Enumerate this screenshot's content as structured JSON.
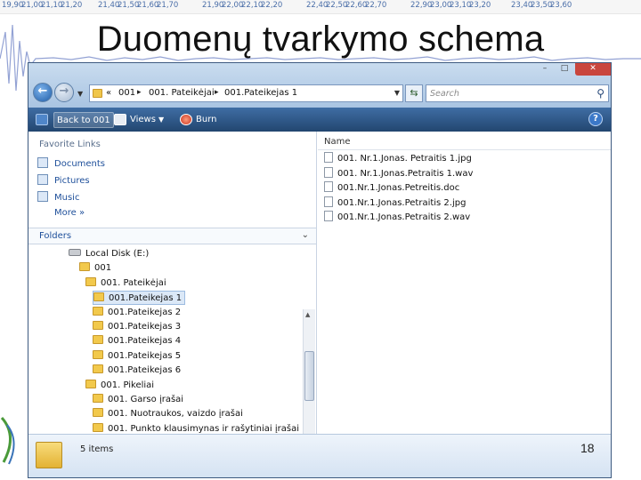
{
  "timeline": [
    "19,90",
    "21,00",
    "21,10",
    "21,20",
    "21,40",
    "21,50",
    "21,60",
    "21,70",
    "21,90",
    "22,00",
    "22,10",
    "22,20",
    "22,40",
    "22,50",
    "22,60",
    "22,70",
    "22,90",
    "23,00",
    "23,10",
    "23,20",
    "23,40",
    "23,50",
    "23,60"
  ],
  "slide": {
    "title": "Duomenų tvarkymo schema",
    "page_number": "18"
  },
  "window": {
    "address": {
      "overflow": "«",
      "crumbs": [
        "001",
        "001. Pateikėjai",
        "001.Pateikejas 1"
      ]
    },
    "search_placeholder": "Search",
    "toolbar": {
      "back_label": "Back to 001",
      "views_label": "Views",
      "burn_label": "Burn"
    },
    "favorites": {
      "header": "Favorite Links",
      "items": [
        "Documents",
        "Pictures",
        "Music",
        "More »"
      ]
    },
    "folders_label": "Folders",
    "tree": [
      {
        "label": "Local Disk (E:)",
        "level": 0,
        "kind": "drive"
      },
      {
        "label": "001",
        "level": 1,
        "kind": "folder"
      },
      {
        "label": "001. Pateikėjai",
        "level": 2,
        "kind": "folder"
      },
      {
        "label": "001.Pateikejas 1",
        "level": 3,
        "kind": "folder",
        "selected": true
      },
      {
        "label": "001.Pateikejas 2",
        "level": 3,
        "kind": "folder"
      },
      {
        "label": "001.Pateikejas 3",
        "level": 3,
        "kind": "folder"
      },
      {
        "label": "001.Pateikejas 4",
        "level": 3,
        "kind": "folder"
      },
      {
        "label": "001.Pateikejas 5",
        "level": 3,
        "kind": "folder"
      },
      {
        "label": "001.Pateikejas 6",
        "level": 3,
        "kind": "folder"
      },
      {
        "label": "001. Pikeliai",
        "level": 2,
        "kind": "folder"
      },
      {
        "label": "001. Garso įrašai",
        "level": 3,
        "kind": "folder"
      },
      {
        "label": "001. Nuotraukos, vaizdo įrašai",
        "level": 3,
        "kind": "folder"
      },
      {
        "label": "001. Punkto klausimynas ir rašytiniai įrašai",
        "level": 3,
        "kind": "folder"
      }
    ],
    "files_header": "Name",
    "files": [
      "001. Nr.1.Jonas. Petraitis 1.jpg",
      "001. Nr.1.Jonas.Petraitis 1.wav",
      "001.Nr.1.Jonas.Petreitis.doc",
      "001.Nr.1.Jonas.Petraitis 2.jpg",
      "001.Nr.1.Jonas.Petraitis 2.wav"
    ],
    "status": "5 items"
  },
  "colors": {
    "toolbar": "#2d5788",
    "addressbar": "#bcd3ec",
    "link": "#1e4f9a",
    "folder": "#f2c94c"
  }
}
